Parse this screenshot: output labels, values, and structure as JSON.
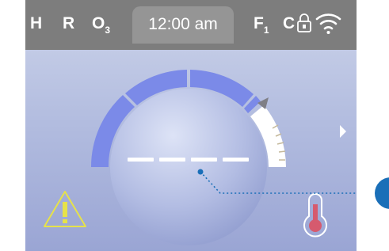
{
  "status_bar": {
    "indicators": [
      {
        "label": "H"
      },
      {
        "label": "R"
      },
      {
        "label": "O",
        "sub": "3"
      }
    ],
    "time": "12:00 am",
    "filter": {
      "label": "F",
      "sub": "1"
    },
    "unit": "C",
    "icons": [
      "lock-icon",
      "wifi-icon"
    ]
  },
  "dial": {
    "setpoint_display": "- - - -",
    "arc_segments": 5,
    "arc_colors": {
      "active": "#7b8ae8",
      "inactive": "#ffffff"
    }
  },
  "icons": {
    "warning": "warning-icon",
    "thermometer": "thermometer-icon",
    "next": "chevron-right-icon"
  },
  "callout": {
    "color": "#1a6fb8"
  },
  "colors": {
    "status_bg": "#7d7d7d",
    "warning": "#e6e24a",
    "thermometer": "#d65a6e"
  }
}
